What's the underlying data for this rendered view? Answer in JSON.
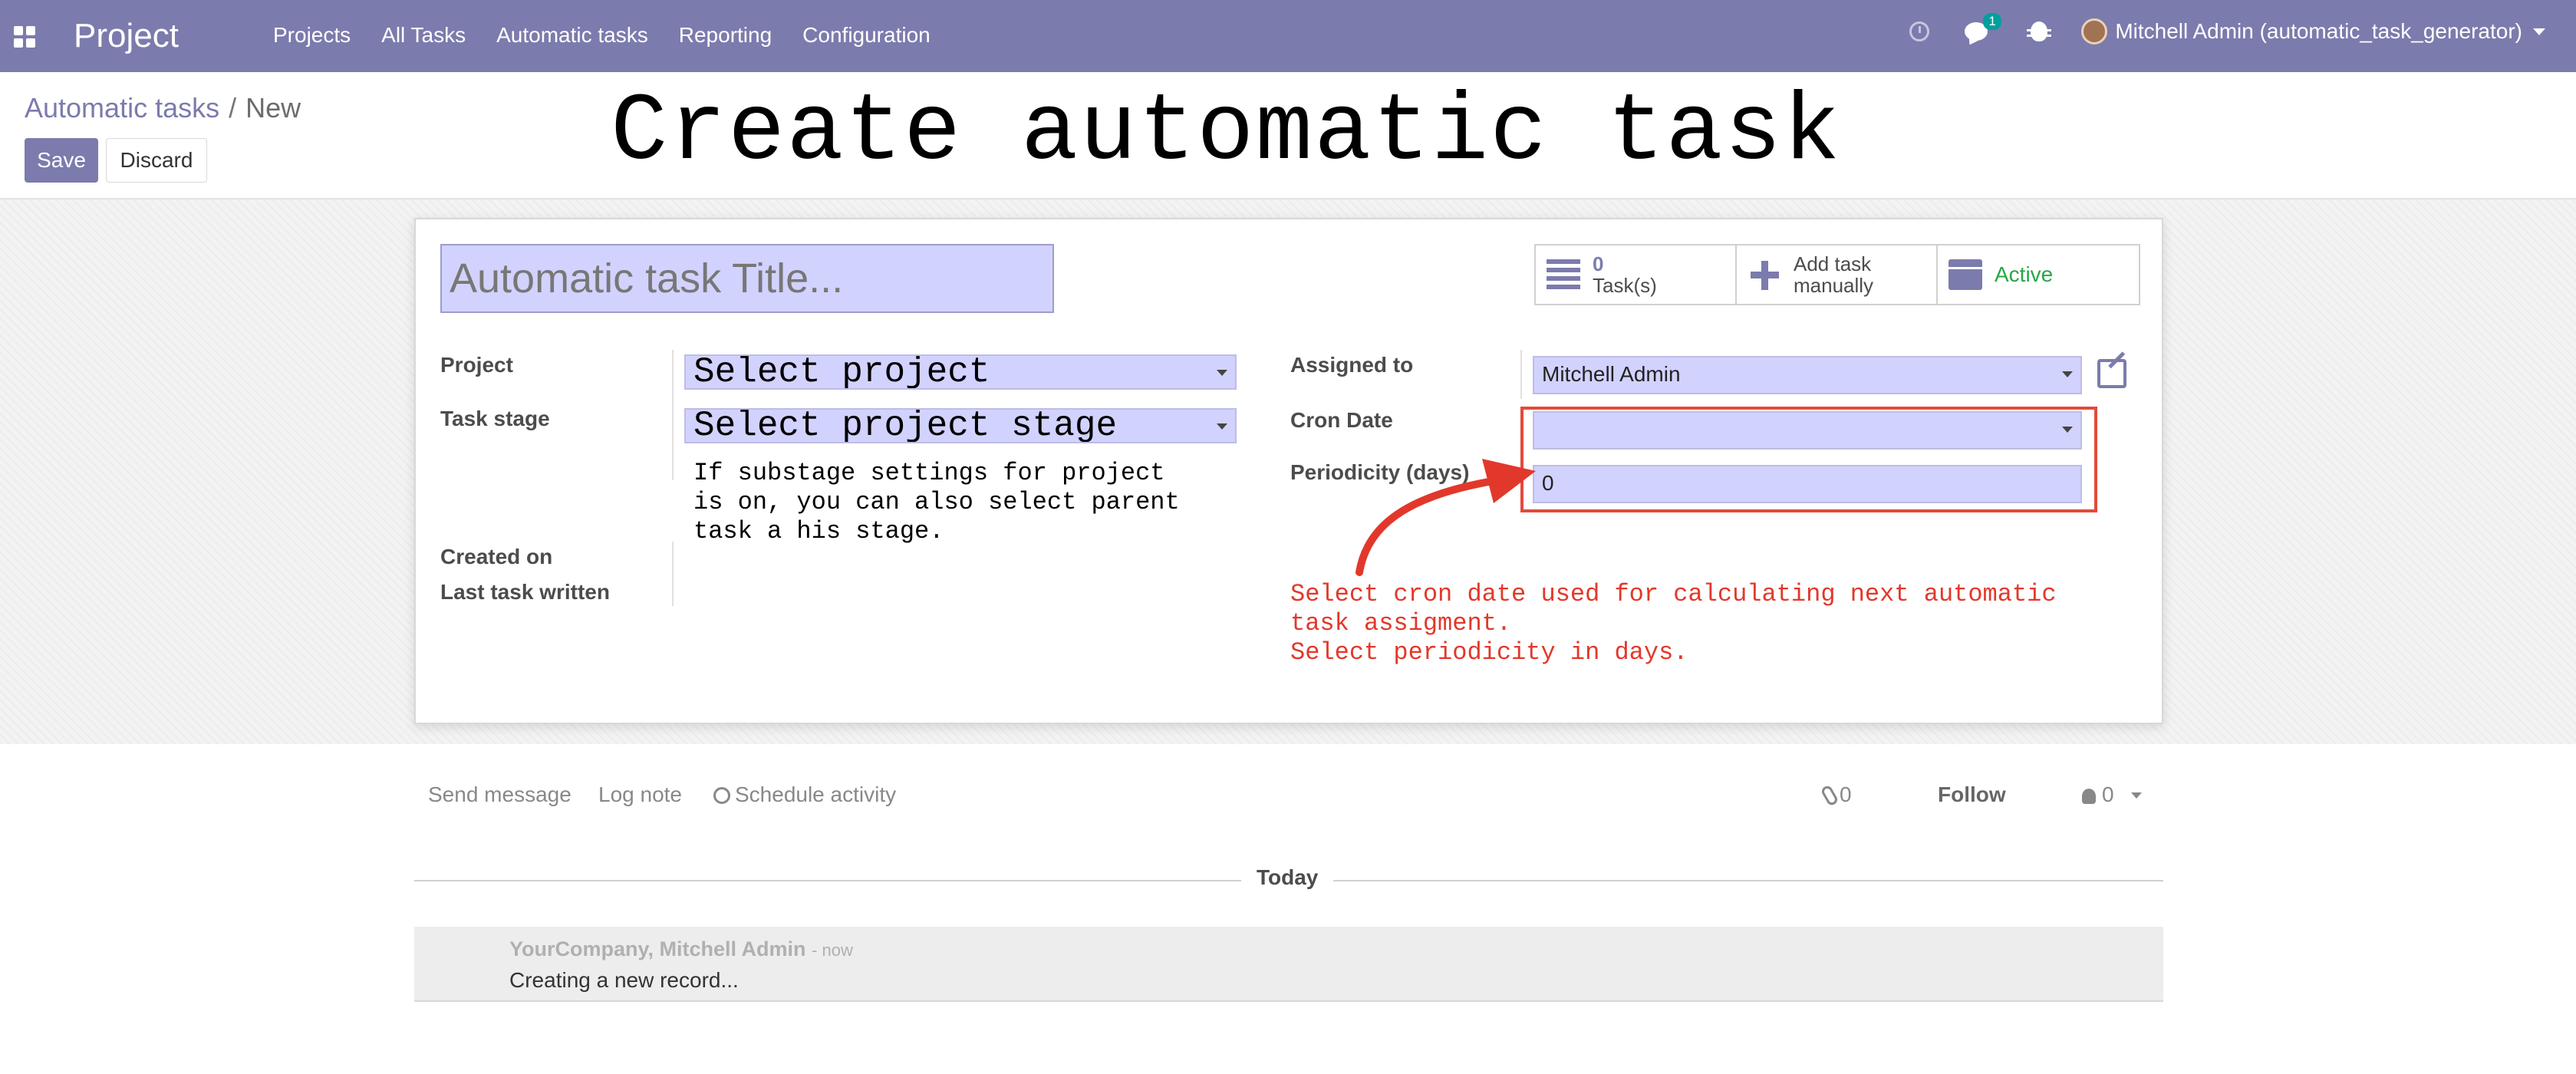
{
  "navbar": {
    "app_title": "Project",
    "menu": [
      "Projects",
      "All Tasks",
      "Automatic tasks",
      "Reporting",
      "Configuration"
    ],
    "chat_badge": "1",
    "user": "Mitchell Admin (automatic_task_generator)"
  },
  "breadcrumb": {
    "parent": "Automatic tasks",
    "separator": "/",
    "current": "New"
  },
  "buttons": {
    "save": "Save",
    "discard": "Discard"
  },
  "banner": {
    "title": "Create automatic task"
  },
  "form": {
    "title_placeholder": "Automatic task Title...",
    "smart_buttons": {
      "tasks_count": "0",
      "tasks_label": "Task(s)",
      "add_task_label": "Add task manually",
      "active_label": "Active"
    },
    "labels": {
      "project": "Project",
      "task_stage": "Task stage",
      "created_on": "Created on",
      "last_task_written": "Last task written",
      "assigned_to": "Assigned to",
      "cron_date": "Cron Date",
      "periodicity": "Periodicity (days)"
    },
    "values": {
      "project": "Select project",
      "task_stage": "Select project stage",
      "assigned_to": "Mitchell Admin",
      "cron_date": "",
      "periodicity": "0"
    },
    "hint": "If substage settings for project\nis on, you can also select parent\ntask a his stage.",
    "annotation": "Select cron date used for calculating next automatic\ntask assigment.\nSelect periodicity in days.",
    "accent_colors": {
      "annotation_red": "#e2382b",
      "field_fill": "#d2d2ff",
      "brand": "#7c7bad"
    }
  },
  "chatter": {
    "send_message": "Send message",
    "log_note": "Log note",
    "schedule_activity": "Schedule activity",
    "attachments_count": "0",
    "follow": "Follow",
    "followers_count": "0",
    "date_separator": "Today",
    "message": {
      "author": "YourCompany, Mitchell Admin",
      "time": "- now",
      "body": "Creating a new record..."
    }
  }
}
